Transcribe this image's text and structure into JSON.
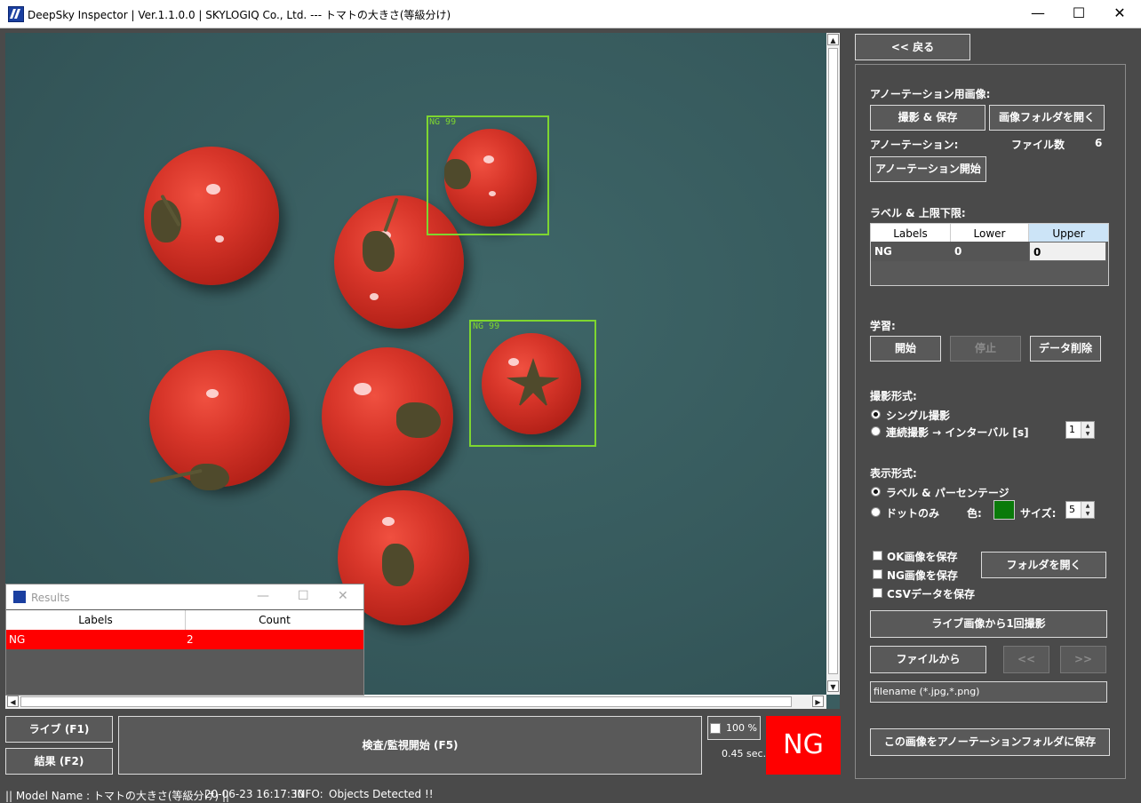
{
  "window": {
    "title": "DeepSky Inspector | Ver.1.1.0.0 | SKYLOGIQ Co., Ltd. --- トマトの大きさ(等級分け)",
    "minimize_glyph": "—",
    "maximize_glyph": "☐",
    "close_glyph": "✕"
  },
  "viewer": {
    "detections": [
      {
        "label": "NG 99"
      },
      {
        "label": "NG 99"
      }
    ],
    "scroll_up": "▲",
    "scroll_down": "▼",
    "scroll_left": "◀",
    "scroll_right": "▶"
  },
  "results_window": {
    "title": "Results",
    "min_glyph": "—",
    "max_glyph": "☐",
    "close_glyph": "✕",
    "columns": [
      "Labels",
      "Count"
    ],
    "rows": [
      {
        "label": "NG",
        "count": "2"
      }
    ]
  },
  "bottom": {
    "live_button": "ライブ (F1)",
    "result_button": "結果 (F2)",
    "inspect_button": "検査/監視開始 (F5)",
    "zoom_label": "100 %",
    "time_label": "0.45 sec.",
    "verdict": "NG"
  },
  "panel": {
    "back_button": "<< 戻る",
    "annotation_image_heading": "アノーテーション用画像:",
    "capture_save_button": "撮影 & 保存",
    "open_image_folder_button": "画像フォルダを開く",
    "annotation_heading": "アノーテーション:",
    "file_count_label": "ファイル数",
    "file_count_value": "6",
    "annotation_start_button": "アノーテーション開始",
    "label_limits_heading": "ラベル & 上限下限:",
    "grid_columns": [
      "Labels",
      "Lower",
      "Upper"
    ],
    "grid_rows": [
      {
        "label": "NG",
        "lower": "0",
        "upper": "0"
      }
    ],
    "training_heading": "学習:",
    "start_button": "開始",
    "stop_button": "停止",
    "delete_data_button": "データ削除",
    "capture_mode_heading": "撮影形式:",
    "single_capture": "シングル撮影",
    "continuous_capture": "連続撮影 → インターバル [s]",
    "interval_value": "1",
    "display_mode_heading": "表示形式:",
    "label_percentage": "ラベル & パーセンテージ",
    "dot_only": "ドットのみ",
    "color_label": "色:",
    "dot_color": "#0a7a0a",
    "size_label": "サイズ:",
    "size_value": "5",
    "save_ok": "OK画像を保存",
    "save_ng": "NG画像を保存",
    "save_csv": "CSVデータを保存",
    "open_folder_button": "フォルダを開く",
    "live_capture_once_button": "ライブ画像から1回撮影",
    "from_file_button": "ファイルから",
    "prev_button": "<<",
    "next_button": ">>",
    "filename_placeholder": "filename (*.jpg,*.png)",
    "save_to_annotation_button": "この画像をアノーテーションフォルダに保存"
  },
  "statusbar": {
    "model_name": "|| Model Name : トマトの大きさ(等級分け) ||",
    "timestamp": "20-06-23 16:17:30",
    "info_label": "INFO:",
    "info_message": "Objects Detected !!"
  }
}
